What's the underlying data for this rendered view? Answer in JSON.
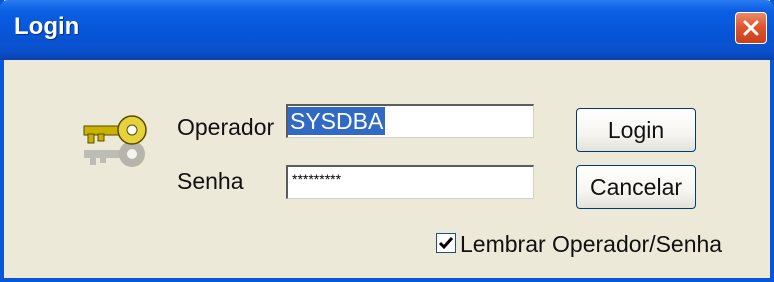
{
  "window": {
    "title": "Login",
    "close_icon": "close-icon"
  },
  "form": {
    "operator_label": "Operador",
    "operator_value": "SYSDBA",
    "password_label": "Senha",
    "password_value": "*********",
    "remember_label": "Lembrar Operador/Senha",
    "remember_checked": true
  },
  "buttons": {
    "login_label": "Login",
    "cancel_label": "Cancelar"
  },
  "icons": {
    "key": "key-icon",
    "checkmark": "checkmark-icon"
  },
  "colors": {
    "titlebar": "#0655d8",
    "window_bg": "#ece9d8",
    "selection": "#316ac5",
    "close_button": "#e0562f"
  }
}
